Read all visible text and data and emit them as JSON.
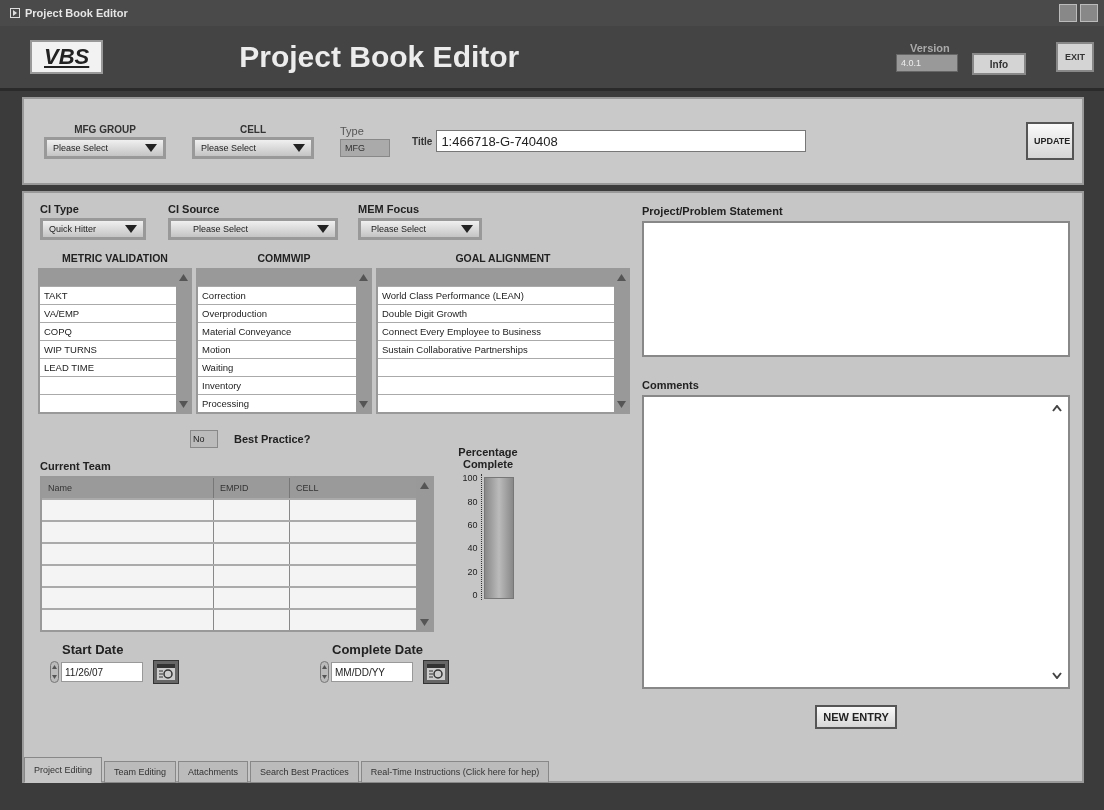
{
  "window": {
    "title": "Project Book Editor"
  },
  "header": {
    "logo": "VBS",
    "title": "Project Book Editor",
    "version_label": "Version",
    "version": "4.0.1",
    "info_button": "Info",
    "exit_button": "EXIT"
  },
  "top_panel": {
    "dropdowns": [
      {
        "label": "MFG GROUP",
        "value": "Please Select"
      },
      {
        "label": "CELL",
        "value": "Please Select"
      }
    ],
    "type": {
      "label": "Type",
      "value": "MFG"
    },
    "title_field": {
      "label": "Title",
      "value": "1:466718-G-740408"
    },
    "update_button": "UPDATE"
  },
  "selectors": [
    {
      "label": "CI Type",
      "value": "Quick Hitter"
    },
    {
      "label": "CI Source",
      "value": "Please Select"
    },
    {
      "label": "MEM Focus",
      "value": "Please Select"
    }
  ],
  "lists": [
    {
      "title": "METRIC VALIDATION",
      "items": [
        "TAKT",
        "VA/EMP",
        "COPQ",
        "WIP TURNS",
        "LEAD TIME"
      ]
    },
    {
      "title": "COMMWIP",
      "items": [
        "Correction",
        "Overproduction",
        "Material Conveyance",
        "Motion",
        "Waiting",
        "Inventory",
        "Processing"
      ]
    },
    {
      "title": "GOAL ALIGNMENT",
      "items": [
        "World Class Performance (LEAN)",
        "Double Digit Growth",
        "Connect Every Employee to Business",
        "Sustain Collaborative Partnerships"
      ]
    }
  ],
  "best_practice": {
    "value": "No",
    "label": "Best Practice?"
  },
  "team": {
    "title": "Current Team",
    "columns": [
      "Name",
      "EMPID",
      "CELL"
    ]
  },
  "progress": {
    "label": "Percentage Complete",
    "level": 0,
    "scale": [
      "100",
      "80",
      "60",
      "40",
      "20",
      "0"
    ]
  },
  "dates": [
    {
      "label": "Start Date",
      "value": "11/26/07"
    },
    {
      "label": "Complete Date",
      "placeholder": "MM/DD/YY"
    }
  ],
  "statement": {
    "label": "Project/Problem Statement"
  },
  "comments": {
    "label": "Comments"
  },
  "new_entry_button": "NEW ENTRY",
  "tabs": [
    {
      "label": "Project Editing",
      "selected": true
    },
    {
      "label": "Team Editing",
      "selected": false
    },
    {
      "label": "Attachments",
      "selected": false
    },
    {
      "label": "Search Best Practices",
      "selected": false
    },
    {
      "label": "Real-Time Instructions (Click here for hep)",
      "selected": false
    }
  ]
}
